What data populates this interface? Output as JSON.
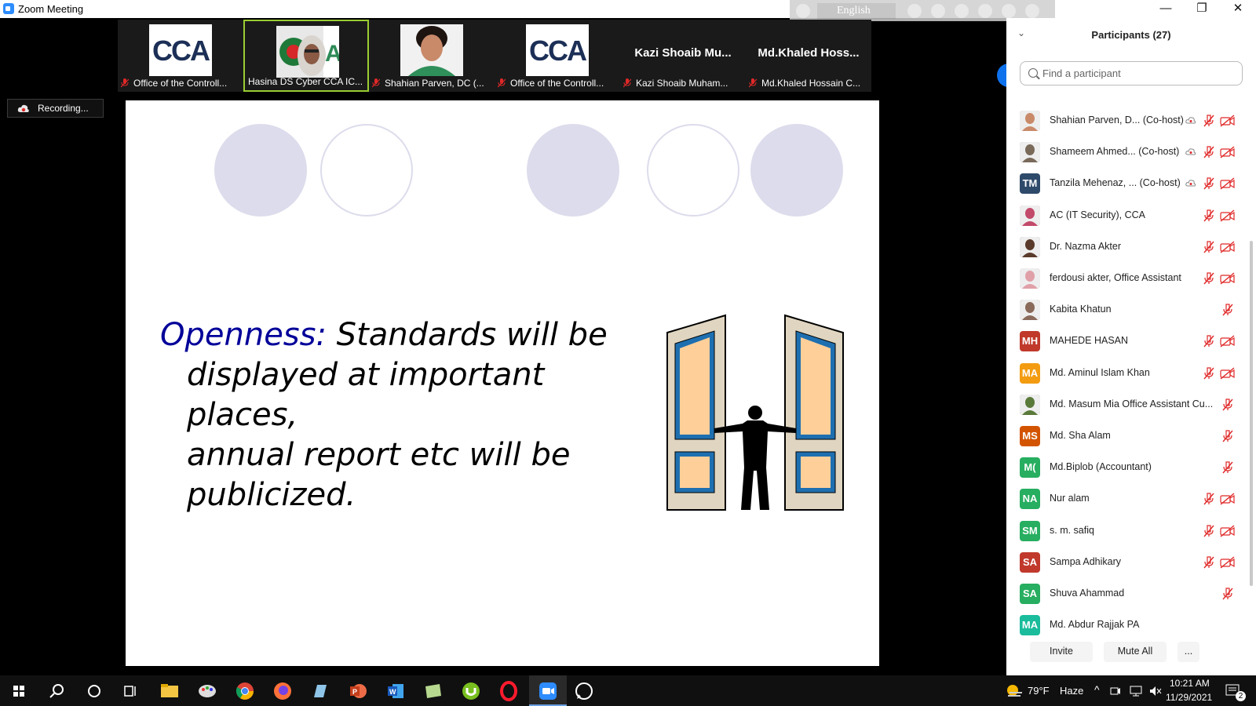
{
  "window": {
    "title": "Zoom Meeting",
    "minimize": "—",
    "maximize": "❐",
    "close": "✕"
  },
  "language_bar": {
    "language": "English"
  },
  "gallery": [
    {
      "tile_type": "logo",
      "logo_text": "CCA",
      "label": "Office of the Controll...",
      "muted": true
    },
    {
      "tile_type": "video",
      "label": "Hasina DS Cyber CCA IC...",
      "muted": false,
      "active": true
    },
    {
      "tile_type": "video",
      "label": "Shahian Parven, DC (...",
      "muted": true
    },
    {
      "tile_type": "logo",
      "logo_text": "CCA",
      "label": "Office of the Controll...",
      "muted": true
    },
    {
      "tile_type": "name",
      "display_name": "Kazi  Shoaib  Mu...",
      "label": "Kazi Shoaib Muham...",
      "muted": true
    },
    {
      "tile_type": "name",
      "display_name": "Md.Khaled  Hoss...",
      "label": "Md.Khaled Hossain C...",
      "muted": true
    }
  ],
  "recording": {
    "label": "Recording..."
  },
  "slide": {
    "keyword": "Openness",
    "colon": ":",
    "line1": " Standards will be",
    "line2": "displayed at important places,",
    "line3": "annual report etc will be",
    "line4": "publicized",
    "line4_end": "."
  },
  "participants": {
    "title": "Participants (27)",
    "search_placeholder": "Find a participant",
    "items": [
      {
        "name": "Shahian Parven, D... (Co-host)",
        "avatar": "photo",
        "avatar_color": "#c98a6a",
        "cloud": true,
        "mic_muted": true,
        "video_off": true
      },
      {
        "name": "Shameem Ahmed...  (Co-host)",
        "avatar": "photo",
        "avatar_color": "#7a6a5a",
        "cloud": true,
        "mic_muted": true,
        "video_off": true
      },
      {
        "name": "Tanzila Mehenaz, ... (Co-host)",
        "avatar": "TM",
        "avatar_color": "#2e4a6b",
        "cloud": true,
        "mic_muted": true,
        "video_off": true
      },
      {
        "name": "AC (IT Security), CCA",
        "avatar": "photo",
        "avatar_color": "#c24a6a",
        "cloud": false,
        "mic_muted": true,
        "video_off": true
      },
      {
        "name": "Dr. Nazma Akter",
        "avatar": "photo",
        "avatar_color": "#5a3a2a",
        "cloud": false,
        "mic_muted": true,
        "video_off": true
      },
      {
        "name": "ferdousi akter, Office Assistant",
        "avatar": "photo",
        "avatar_color": "#e0a0a8",
        "cloud": false,
        "mic_muted": true,
        "video_off": true
      },
      {
        "name": "Kabita Khatun",
        "avatar": "photo",
        "avatar_color": "#8a6a5a",
        "cloud": false,
        "mic_muted": true,
        "video_off": false
      },
      {
        "name": "MAHEDE HASAN",
        "avatar": "MH",
        "avatar_color": "#c0392b",
        "cloud": false,
        "mic_muted": true,
        "video_off": true
      },
      {
        "name": "Md. Aminul Islam Khan",
        "avatar": "MA",
        "avatar_color": "#f39c12",
        "cloud": false,
        "mic_muted": true,
        "video_off": true
      },
      {
        "name": "Md. Masum Mia Office Assistant Cu...",
        "avatar": "photo",
        "avatar_color": "#5a7a3a",
        "cloud": false,
        "mic_muted": true,
        "video_off": false
      },
      {
        "name": "Md. Sha Alam",
        "avatar": "MS",
        "avatar_color": "#d35400",
        "cloud": false,
        "mic_muted": true,
        "video_off": false
      },
      {
        "name": "Md.Biplob (Accountant)",
        "avatar": "M(",
        "avatar_color": "#27ae60",
        "cloud": false,
        "mic_muted": true,
        "video_off": false
      },
      {
        "name": "Nur alam",
        "avatar": "NA",
        "avatar_color": "#27ae60",
        "cloud": false,
        "mic_muted": true,
        "video_off": true
      },
      {
        "name": "s. m. safiq",
        "avatar": "SM",
        "avatar_color": "#27ae60",
        "cloud": false,
        "mic_muted": true,
        "video_off": true
      },
      {
        "name": "Sampa Adhikary",
        "avatar": "SA",
        "avatar_color": "#c0392b",
        "cloud": false,
        "mic_muted": true,
        "video_off": true
      },
      {
        "name": "Shuva Ahammad",
        "avatar": "SA",
        "avatar_color": "#27ae60",
        "cloud": false,
        "mic_muted": true,
        "video_off": false
      },
      {
        "name": "Md. Abdur Rajjak PA",
        "avatar": "MA",
        "avatar_color": "#1abc9c",
        "cloud": false,
        "mic_muted": false,
        "video_off": false
      }
    ],
    "invite_label": "Invite",
    "mute_all_label": "Mute All",
    "more_label": "..."
  },
  "taskbar": {
    "weather_temp": "79°F",
    "weather_desc": "Haze",
    "time": "10:21 AM",
    "date": "11/29/2021",
    "notification_count": "2",
    "apps": [
      "start-icon",
      "search-icon",
      "cortana-icon",
      "task-view-icon",
      "file-explorer-icon",
      "paint-icon",
      "chrome-icon",
      "firefox-icon",
      "notepad-icon",
      "powerpoint-icon",
      "word-icon",
      "notes-icon",
      "utorrent-icon",
      "opera-icon",
      "zoom-icon",
      "whatsapp-icon"
    ]
  }
}
